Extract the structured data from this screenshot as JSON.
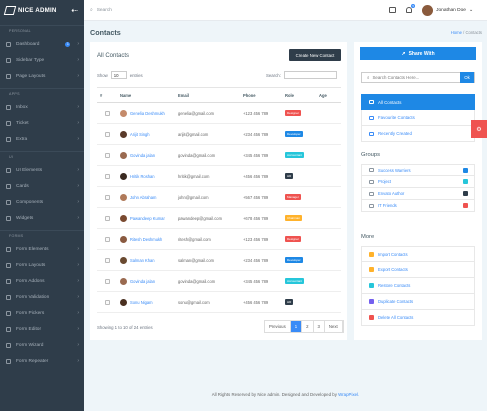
{
  "brand": {
    "name": "NICE ADMIN"
  },
  "sidebar": {
    "sec_personal": "PERSONAL",
    "sec_apps": "APPS",
    "sec_ui": "UI",
    "sec_forms": "FORMS",
    "personal": [
      {
        "label": "Dashboard",
        "badge": "1"
      },
      {
        "label": "Sidebar Type"
      },
      {
        "label": "Page Layouts"
      }
    ],
    "apps": [
      {
        "label": "Inbox"
      },
      {
        "label": "Ticket"
      },
      {
        "label": "Extra"
      }
    ],
    "ui": [
      {
        "label": "UI Elements"
      },
      {
        "label": "Cards"
      },
      {
        "label": "Components"
      },
      {
        "label": "Widgets"
      }
    ],
    "forms": [
      {
        "label": "Form Elements"
      },
      {
        "label": "Form Layouts"
      },
      {
        "label": "Form Addons"
      },
      {
        "label": "Form Validation"
      },
      {
        "label": "Form Pickers"
      },
      {
        "label": "Form Editor"
      },
      {
        "label": "Form Wizard"
      },
      {
        "label": "Form Repeater"
      }
    ]
  },
  "topbar": {
    "search_placeholder": "Search",
    "notif_count": "5",
    "user_name": "Jonathan Doe"
  },
  "page": {
    "title": "Contacts",
    "bc_home": "Home",
    "bc_sep": "/",
    "bc_current": "Contacts"
  },
  "contacts": {
    "title": "All Contacts",
    "create_button": "Create New Contact",
    "show_label": "Show",
    "show_value": "10",
    "entries_label": "entries",
    "search_label": "Search:",
    "columns": [
      "#",
      "Name",
      "Email",
      "Phone",
      "Role",
      "Age"
    ],
    "rows": [
      {
        "name": "Genelia Deshmukh",
        "email": "genelia@gmail.com",
        "phone": "+123 456 789",
        "role": "Designer",
        "role_color": "#ef5350"
      },
      {
        "name": "Arijit Singh",
        "email": "arijit@gmail.com",
        "phone": "+234 456 789",
        "role": "Developer",
        "role_color": "#1e88e5"
      },
      {
        "name": "Govinda jalan",
        "email": "govinda@gmail.com",
        "phone": "+345 456 789",
        "role": "Accountant",
        "role_color": "#26c6da"
      },
      {
        "name": "Hritik Roshan",
        "email": "hritik@gmail.com",
        "phone": "+456 456 789",
        "role": "HR",
        "role_color": "#2f3d4a"
      },
      {
        "name": "John Abraham",
        "email": "john@gmail.com",
        "phone": "+567 456 789",
        "role": "Manager",
        "role_color": "#ef5350"
      },
      {
        "name": "Pawandeep Kumar",
        "email": "pawandeep@gmail.com",
        "phone": "+678 456 789",
        "role": "Chairman",
        "role_color": "#ffb22b"
      },
      {
        "name": "Ritesh Deshmukh",
        "email": "ritesh@gmail.com",
        "phone": "+123 456 789",
        "role": "Designer",
        "role_color": "#ef5350"
      },
      {
        "name": "Salman Khan",
        "email": "salman@gmail.com",
        "phone": "+234 456 789",
        "role": "Developer",
        "role_color": "#1e88e5"
      },
      {
        "name": "Govinda jalan",
        "email": "govinda@gmail.com",
        "phone": "+345 456 789",
        "role": "Accountant",
        "role_color": "#26c6da"
      },
      {
        "name": "Sonu Nigam",
        "email": "sonu@gmail.com",
        "phone": "+456 456 789",
        "role": "HR",
        "role_color": "#2f3d4a"
      }
    ],
    "info": "Showing 1 to 10 of 24 entries",
    "pagination": {
      "prev": "Previous",
      "pages": [
        "1",
        "2",
        "3"
      ],
      "next": "Next"
    }
  },
  "panel": {
    "share": "Share With",
    "search_placeholder": "Search Contacts Here...",
    "ok": "Ok",
    "lists": [
      {
        "label": "All Contacts"
      },
      {
        "label": "Favourite Contacts"
      },
      {
        "label": "Recently Created"
      }
    ],
    "groups_title": "Groups",
    "groups": [
      {
        "label": "Success Warriers",
        "color": "#1e88e5"
      },
      {
        "label": "Project",
        "color": "#26c6da"
      },
      {
        "label": "Envato Author",
        "color": "#2f3d4a"
      },
      {
        "label": "IT Friends",
        "color": "#ef5350"
      }
    ],
    "more_title": "More",
    "more": [
      {
        "label": "Import Contacts",
        "color": "#ffb22b"
      },
      {
        "label": "Export Contacts",
        "color": "#ffb22b"
      },
      {
        "label": "Restore Contacts",
        "color": "#26c6da"
      },
      {
        "label": "Duplicate Contacts",
        "color": "#7460ee"
      },
      {
        "label": "Delete All Contacts",
        "color": "#ef5350"
      }
    ]
  },
  "footer": {
    "text": "All Rights Reserved by Nice admin. Designed and Developed by",
    "link": "WrapPixel."
  }
}
